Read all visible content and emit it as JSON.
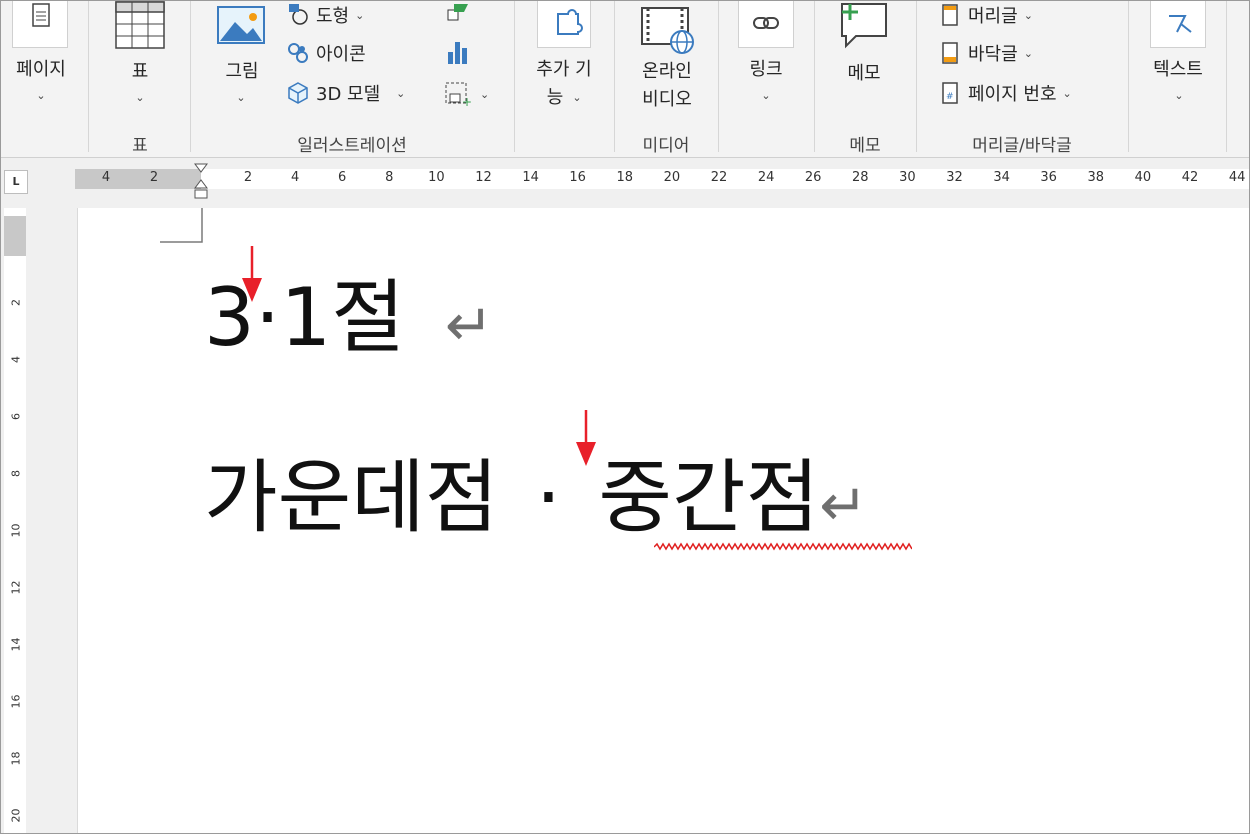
{
  "ribbon": {
    "groups": {
      "page": {
        "label": "페이지"
      },
      "table": {
        "label": "표",
        "group_label": "표"
      },
      "illustrations": {
        "group_label": "일러스트레이션",
        "picture": "그림",
        "shapes": "도형",
        "icons": "아이콘",
        "models3d": "3D 모델"
      },
      "addins": {
        "label": "추가 기능",
        "label_line1": "추가 기",
        "label_line2": "능"
      },
      "media": {
        "group_label": "미디어",
        "online_video_line1": "온라인",
        "online_video_line2": "비디오"
      },
      "links": {
        "label": "링크"
      },
      "comments": {
        "label": "메모",
        "group_label": "메모"
      },
      "header_footer": {
        "group_label": "머리글/바닥글",
        "header": "머리글",
        "footer": "바닥글",
        "page_number": "페이지 번호"
      },
      "text": {
        "label": "텍스트"
      }
    }
  },
  "ruler": {
    "horizontal_ticks": [
      "4",
      "2",
      "2",
      "4",
      "6",
      "8",
      "10",
      "12",
      "14",
      "16",
      "18",
      "20",
      "22",
      "24",
      "26",
      "28",
      "30",
      "32",
      "34",
      "36",
      "38",
      "40",
      "42",
      "44"
    ],
    "vertical_ticks": [
      "2",
      "4",
      "6",
      "8",
      "10",
      "12",
      "14",
      "16",
      "18",
      "20"
    ],
    "tab_selector": "L"
  },
  "document": {
    "line1": {
      "text": "3·1절",
      "paragraph_mark": "↵"
    },
    "line2": {
      "before": "가운데점",
      "middot": "·",
      "after": "중간점",
      "paragraph_mark": "↵"
    }
  },
  "colors": {
    "annotation_arrow": "#e8202a",
    "spellcheck": "#e02020",
    "ribbon_bg": "#f3f3f3"
  }
}
